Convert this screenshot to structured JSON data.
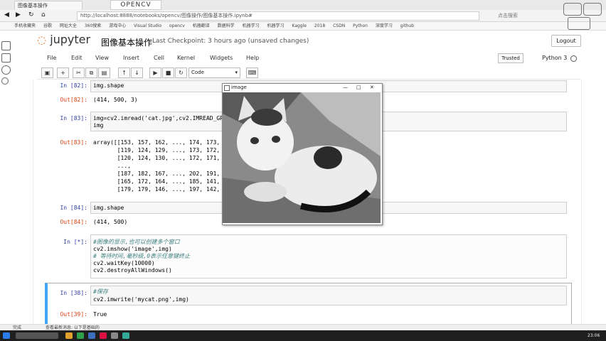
{
  "browser": {
    "tabs": [
      "图像基本操作",
      ""
    ],
    "watermark": "OPENCV",
    "url_prefix": "http://",
    "url": "localhost:8888/notebooks/opencv/图像操作/图像基本操作.ipynb#",
    "search_hint": "点击搜索",
    "bookmarks": [
      "手机收藏夹",
      "谷歌",
      "网址大全",
      "360搜索",
      "游戏中心",
      "Visual Studio",
      "opencv",
      "机器翻译",
      "数据科学",
      "机器学习",
      "机器学习",
      "Kaggle",
      "2018",
      "CSDN",
      "Python",
      "深度学习",
      "github"
    ]
  },
  "jupyter": {
    "brand": "jupyter",
    "notebook_title": "图像基本操作",
    "checkpoint": "Last Checkpoint: 3 hours ago (unsaved changes)",
    "logout": "Logout",
    "menu": [
      "File",
      "Edit",
      "View",
      "Insert",
      "Cell",
      "Kernel",
      "Widgets",
      "Help"
    ],
    "trusted": "Trusted",
    "kernel": "Python 3",
    "cell_type": "Code"
  },
  "cells": {
    "c1_in": "In [82]:",
    "c1_code": "img.shape",
    "c1_out": "Out[82]:",
    "c1_result": "(414, 500, 3)",
    "c2_in": "In [83]:",
    "c2_code": "img=cv2.imread('cat.jpg',cv2.IMREAD_GRA\nimg",
    "c2_out": "Out[83]:",
    "c2_result": "array([[153, 157, 162, ..., 174, 173, 1\n       [119, 124, 129, ..., 173, 172, 1\n       [120, 124, 130, ..., 172, 171, 1\n       ...,\n       [187, 182, 167, ..., 202, 191, 1\n       [165, 172, 164, ..., 185, 141, 1\n       [179, 179, 146, ..., 197, 142, 1",
    "c3_in": "In [84]:",
    "c3_code": "img.shape",
    "c3_out": "Out[84]:",
    "c3_result": "(414, 500)",
    "c4_in": "In [*]:",
    "c4_comment1": "#图像的显示,也可以创建多个窗口",
    "c4_line2": "cv2.imshow('image',img)",
    "c4_comment2": "# 等待时间,毫秒级,0表示任意键终止",
    "c4_line4": "cv2.waitKey(10000)",
    "c4_line5": "cv2.destroyAllWindows()",
    "c5_in": "In [38]:",
    "c5_comment": "#保存",
    "c5_code": "cv2.imwrite('mycat.png',img)",
    "c5_out": "Out[39]:",
    "c5_result": "True"
  },
  "image_window": {
    "title": "image"
  },
  "status": {
    "text": "完成",
    "left_text": "查看最新消息: 以下是基础的",
    "clock": "23:06"
  }
}
